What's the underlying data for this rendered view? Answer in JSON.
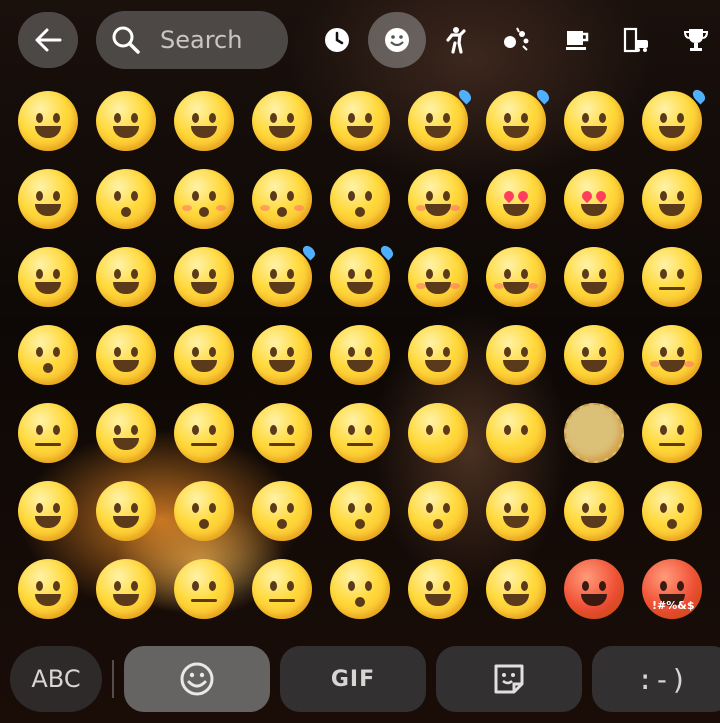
{
  "top_bar": {
    "search": {
      "placeholder": "Search"
    },
    "categories": [
      {
        "name": "recent",
        "icon": "clock-icon"
      },
      {
        "name": "smileys",
        "icon": "smiley-icon",
        "active": true
      },
      {
        "name": "people",
        "icon": "person-icon"
      },
      {
        "name": "animals-nature",
        "icon": "paw-icon"
      },
      {
        "name": "food-drink",
        "icon": "cup-icon"
      },
      {
        "name": "travel-places",
        "icon": "building-car-icon"
      },
      {
        "name": "activities",
        "icon": "trophy-icon"
      }
    ]
  },
  "emoji_grid": {
    "rows": [
      [
        "😀",
        "😃",
        "😄",
        "😁",
        "😆",
        "😅",
        "😂",
        "🤣",
        "😭"
      ],
      [
        "😉",
        "😗",
        "😙",
        "😚",
        "😘",
        "🥰",
        "😍",
        "🤩",
        "🥳"
      ],
      [
        "🫠",
        "🙃",
        "🙂",
        "🥲",
        "🥹",
        "😊",
        "☺️",
        "😌",
        "😔"
      ],
      [
        "😮‍💨",
        "😏",
        "🤤",
        "😋",
        "😛",
        "😝",
        "😜",
        "🤪",
        "🥴"
      ],
      [
        "😔",
        "🥺",
        "😬",
        "😑",
        "😐",
        "😶",
        "😶‍🌫️",
        "🫥",
        "🤐"
      ],
      [
        "🫡",
        "🤔",
        "🤫",
        "🫢",
        "🤭",
        "🥱",
        "🤗",
        "🫣",
        "😱"
      ],
      [
        "🤨",
        "🧐",
        "😒",
        "🙄",
        "😮‍💨",
        "😤",
        "😠",
        "😡",
        "🤬"
      ]
    ],
    "colors": {
      "face_fill": "#ffd93b",
      "angry_fill": "#f2553a",
      "feature": "#5a3a1a"
    }
  },
  "bottom_bar": {
    "abc_label": "ABC",
    "gif_label": "GIF",
    "emoticon_label": ":-)"
  }
}
